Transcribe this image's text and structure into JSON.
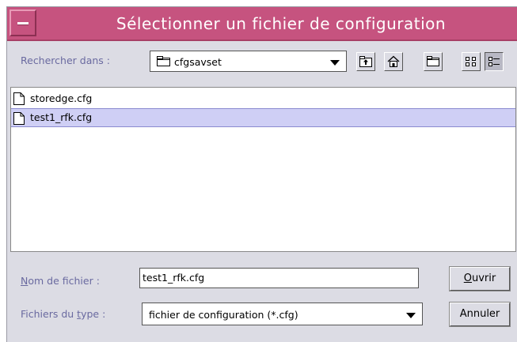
{
  "window": {
    "title": "Sélectionner un fichier de configuration"
  },
  "look_in": {
    "label": "Rechercher dans :",
    "value": "cfgsavset"
  },
  "toolbar": {
    "up_icon": "up-folder-icon",
    "home_icon": "home-icon",
    "new_folder_icon": "new-folder-icon",
    "list_view_icon": "list-view-icon",
    "details_view_icon": "details-view-icon"
  },
  "files": [
    {
      "name": "storedge.cfg",
      "selected": false
    },
    {
      "name": "test1_rfk.cfg",
      "selected": true
    }
  ],
  "filename": {
    "label_prefix": "N",
    "label_rest": "om de fichier :",
    "value": "test1_rfk.cfg"
  },
  "filetype": {
    "label_prefix": "Fichiers du ",
    "label_underline": "t",
    "label_rest": "ype :",
    "value": "fichier de configuration (*.cfg)"
  },
  "buttons": {
    "open_underline": "O",
    "open_rest": "uvrir",
    "cancel": "Annuler"
  },
  "colors": {
    "titlebar": "#c6537f",
    "selection": "#cfcff5",
    "label": "#6a6aa0"
  }
}
